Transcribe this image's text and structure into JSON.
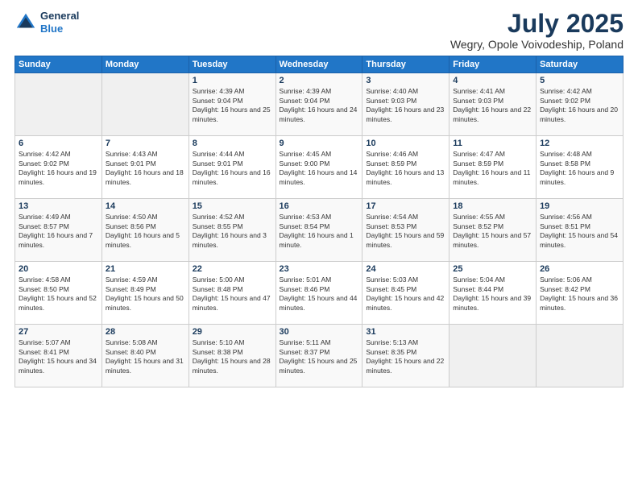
{
  "header": {
    "logo_general": "General",
    "logo_blue": "Blue",
    "month_title": "July 2025",
    "subtitle": "Wegry, Opole Voivodeship, Poland"
  },
  "days_of_week": [
    "Sunday",
    "Monday",
    "Tuesday",
    "Wednesday",
    "Thursday",
    "Friday",
    "Saturday"
  ],
  "weeks": [
    [
      {
        "day": "",
        "sunrise": "",
        "sunset": "",
        "daylight": ""
      },
      {
        "day": "",
        "sunrise": "",
        "sunset": "",
        "daylight": ""
      },
      {
        "day": "1",
        "sunrise": "Sunrise: 4:39 AM",
        "sunset": "Sunset: 9:04 PM",
        "daylight": "Daylight: 16 hours and 25 minutes."
      },
      {
        "day": "2",
        "sunrise": "Sunrise: 4:39 AM",
        "sunset": "Sunset: 9:04 PM",
        "daylight": "Daylight: 16 hours and 24 minutes."
      },
      {
        "day": "3",
        "sunrise": "Sunrise: 4:40 AM",
        "sunset": "Sunset: 9:03 PM",
        "daylight": "Daylight: 16 hours and 23 minutes."
      },
      {
        "day": "4",
        "sunrise": "Sunrise: 4:41 AM",
        "sunset": "Sunset: 9:03 PM",
        "daylight": "Daylight: 16 hours and 22 minutes."
      },
      {
        "day": "5",
        "sunrise": "Sunrise: 4:42 AM",
        "sunset": "Sunset: 9:02 PM",
        "daylight": "Daylight: 16 hours and 20 minutes."
      }
    ],
    [
      {
        "day": "6",
        "sunrise": "Sunrise: 4:42 AM",
        "sunset": "Sunset: 9:02 PM",
        "daylight": "Daylight: 16 hours and 19 minutes."
      },
      {
        "day": "7",
        "sunrise": "Sunrise: 4:43 AM",
        "sunset": "Sunset: 9:01 PM",
        "daylight": "Daylight: 16 hours and 18 minutes."
      },
      {
        "day": "8",
        "sunrise": "Sunrise: 4:44 AM",
        "sunset": "Sunset: 9:01 PM",
        "daylight": "Daylight: 16 hours and 16 minutes."
      },
      {
        "day": "9",
        "sunrise": "Sunrise: 4:45 AM",
        "sunset": "Sunset: 9:00 PM",
        "daylight": "Daylight: 16 hours and 14 minutes."
      },
      {
        "day": "10",
        "sunrise": "Sunrise: 4:46 AM",
        "sunset": "Sunset: 8:59 PM",
        "daylight": "Daylight: 16 hours and 13 minutes."
      },
      {
        "day": "11",
        "sunrise": "Sunrise: 4:47 AM",
        "sunset": "Sunset: 8:59 PM",
        "daylight": "Daylight: 16 hours and 11 minutes."
      },
      {
        "day": "12",
        "sunrise": "Sunrise: 4:48 AM",
        "sunset": "Sunset: 8:58 PM",
        "daylight": "Daylight: 16 hours and 9 minutes."
      }
    ],
    [
      {
        "day": "13",
        "sunrise": "Sunrise: 4:49 AM",
        "sunset": "Sunset: 8:57 PM",
        "daylight": "Daylight: 16 hours and 7 minutes."
      },
      {
        "day": "14",
        "sunrise": "Sunrise: 4:50 AM",
        "sunset": "Sunset: 8:56 PM",
        "daylight": "Daylight: 16 hours and 5 minutes."
      },
      {
        "day": "15",
        "sunrise": "Sunrise: 4:52 AM",
        "sunset": "Sunset: 8:55 PM",
        "daylight": "Daylight: 16 hours and 3 minutes."
      },
      {
        "day": "16",
        "sunrise": "Sunrise: 4:53 AM",
        "sunset": "Sunset: 8:54 PM",
        "daylight": "Daylight: 16 hours and 1 minute."
      },
      {
        "day": "17",
        "sunrise": "Sunrise: 4:54 AM",
        "sunset": "Sunset: 8:53 PM",
        "daylight": "Daylight: 15 hours and 59 minutes."
      },
      {
        "day": "18",
        "sunrise": "Sunrise: 4:55 AM",
        "sunset": "Sunset: 8:52 PM",
        "daylight": "Daylight: 15 hours and 57 minutes."
      },
      {
        "day": "19",
        "sunrise": "Sunrise: 4:56 AM",
        "sunset": "Sunset: 8:51 PM",
        "daylight": "Daylight: 15 hours and 54 minutes."
      }
    ],
    [
      {
        "day": "20",
        "sunrise": "Sunrise: 4:58 AM",
        "sunset": "Sunset: 8:50 PM",
        "daylight": "Daylight: 15 hours and 52 minutes."
      },
      {
        "day": "21",
        "sunrise": "Sunrise: 4:59 AM",
        "sunset": "Sunset: 8:49 PM",
        "daylight": "Daylight: 15 hours and 50 minutes."
      },
      {
        "day": "22",
        "sunrise": "Sunrise: 5:00 AM",
        "sunset": "Sunset: 8:48 PM",
        "daylight": "Daylight: 15 hours and 47 minutes."
      },
      {
        "day": "23",
        "sunrise": "Sunrise: 5:01 AM",
        "sunset": "Sunset: 8:46 PM",
        "daylight": "Daylight: 15 hours and 44 minutes."
      },
      {
        "day": "24",
        "sunrise": "Sunrise: 5:03 AM",
        "sunset": "Sunset: 8:45 PM",
        "daylight": "Daylight: 15 hours and 42 minutes."
      },
      {
        "day": "25",
        "sunrise": "Sunrise: 5:04 AM",
        "sunset": "Sunset: 8:44 PM",
        "daylight": "Daylight: 15 hours and 39 minutes."
      },
      {
        "day": "26",
        "sunrise": "Sunrise: 5:06 AM",
        "sunset": "Sunset: 8:42 PM",
        "daylight": "Daylight: 15 hours and 36 minutes."
      }
    ],
    [
      {
        "day": "27",
        "sunrise": "Sunrise: 5:07 AM",
        "sunset": "Sunset: 8:41 PM",
        "daylight": "Daylight: 15 hours and 34 minutes."
      },
      {
        "day": "28",
        "sunrise": "Sunrise: 5:08 AM",
        "sunset": "Sunset: 8:40 PM",
        "daylight": "Daylight: 15 hours and 31 minutes."
      },
      {
        "day": "29",
        "sunrise": "Sunrise: 5:10 AM",
        "sunset": "Sunset: 8:38 PM",
        "daylight": "Daylight: 15 hours and 28 minutes."
      },
      {
        "day": "30",
        "sunrise": "Sunrise: 5:11 AM",
        "sunset": "Sunset: 8:37 PM",
        "daylight": "Daylight: 15 hours and 25 minutes."
      },
      {
        "day": "31",
        "sunrise": "Sunrise: 5:13 AM",
        "sunset": "Sunset: 8:35 PM",
        "daylight": "Daylight: 15 hours and 22 minutes."
      },
      {
        "day": "",
        "sunrise": "",
        "sunset": "",
        "daylight": ""
      },
      {
        "day": "",
        "sunrise": "",
        "sunset": "",
        "daylight": ""
      }
    ]
  ]
}
